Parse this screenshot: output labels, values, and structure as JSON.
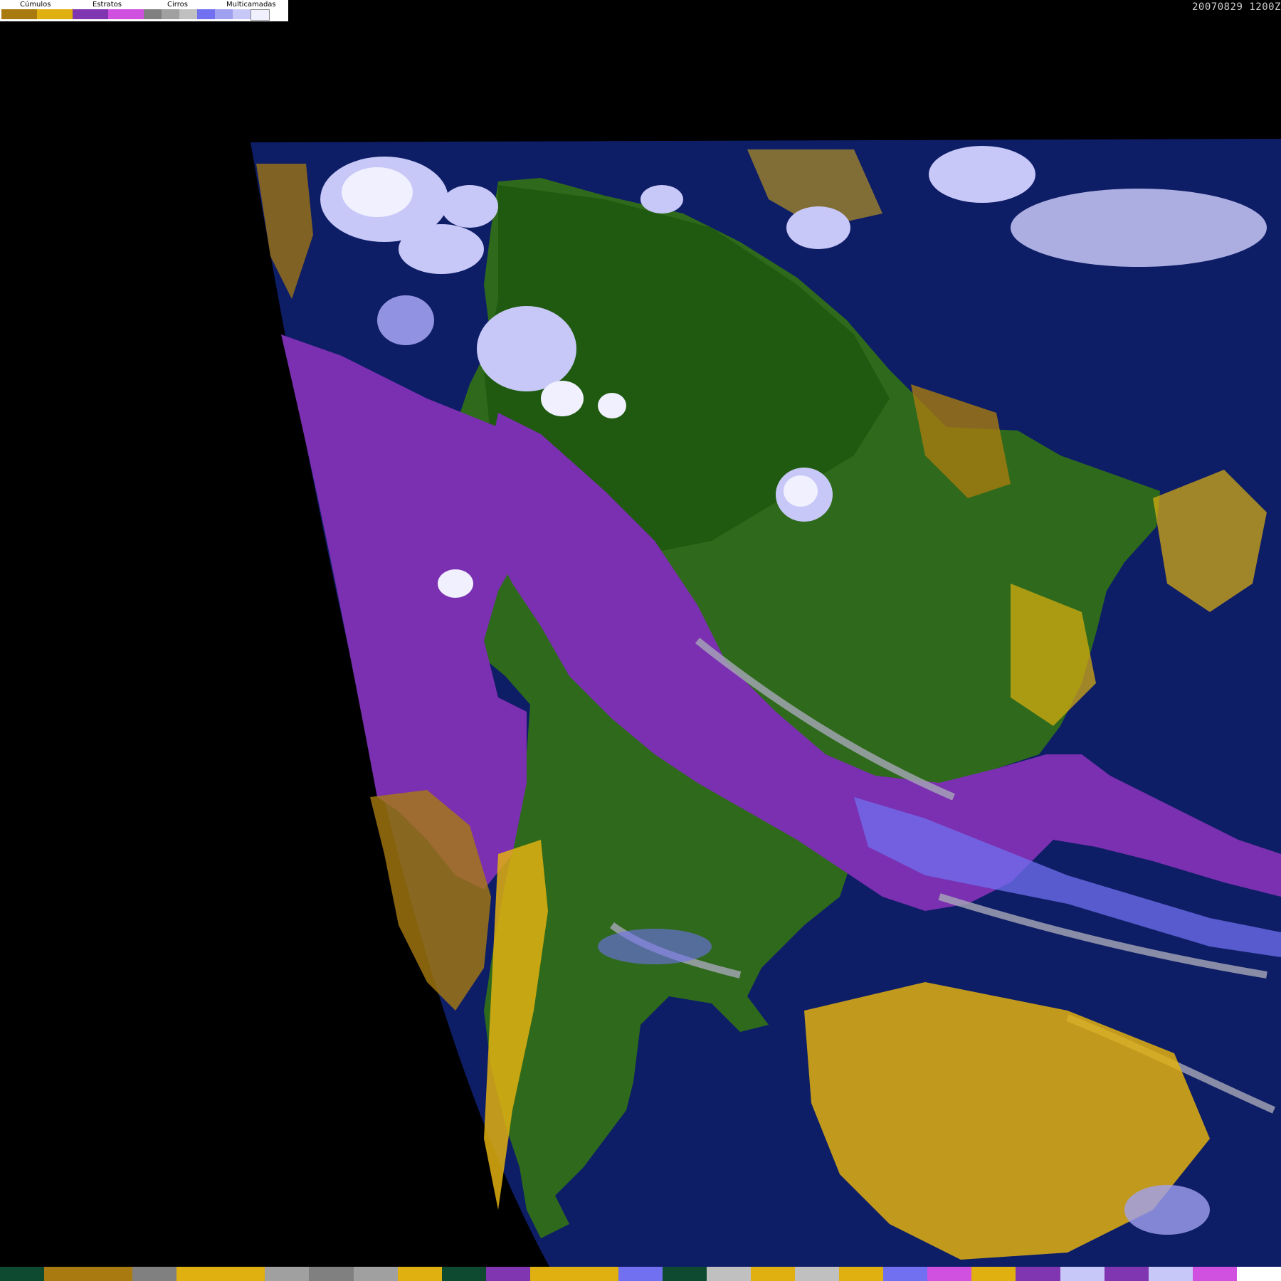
{
  "legend": {
    "groups": [
      {
        "label": "Cúmulos",
        "colors": [
          "#a87a10",
          "#e0b010"
        ]
      },
      {
        "label": "Estratos",
        "colors": [
          "#8036b0",
          "#d050e0"
        ]
      },
      {
        "label": "Cirros",
        "colors": [
          "#808080",
          "#a0a0a0",
          "#c0c0c0"
        ]
      },
      {
        "label": "Multicamadas",
        "colors": [
          "#7070f0",
          "#a0a0f0",
          "#c8c8f8",
          "#f0f0ff"
        ]
      }
    ]
  },
  "timestamp": "20070829 1200Z",
  "colors": {
    "background": "#000000",
    "ocean": "#0e1e66",
    "land": "#2f6a1c",
    "land_dark": "#1f5a10",
    "stratus": "#7a30b0",
    "stratus_light": "#d050e0",
    "cumulus": "#e0b010",
    "cumulus_dark": "#a87a10",
    "cirrus": "#a8a8b8",
    "multilayer": "#c8c8f8",
    "multilayer_bright": "#f0f0ff",
    "multilayer_blue": "#7070f0"
  },
  "bottom_bar_colors": [
    "#0e4a30",
    "#a87a10",
    "#a87a10",
    "#808080",
    "#e0b010",
    "#e0b010",
    "#a0a0a0",
    "#808080",
    "#a0a0a0",
    "#e0b010",
    "#0e4a30",
    "#8036b0",
    "#e0b010",
    "#e0b010",
    "#7070f0",
    "#0e4a30",
    "#c0c0c0",
    "#e0b010",
    "#c0c0c0",
    "#e0b010",
    "#7070f0",
    "#d050e0",
    "#e0b010",
    "#8036b0",
    "#c8c8f8",
    "#8036b0",
    "#c8c8f8",
    "#d050e0",
    "#ffffff"
  ]
}
